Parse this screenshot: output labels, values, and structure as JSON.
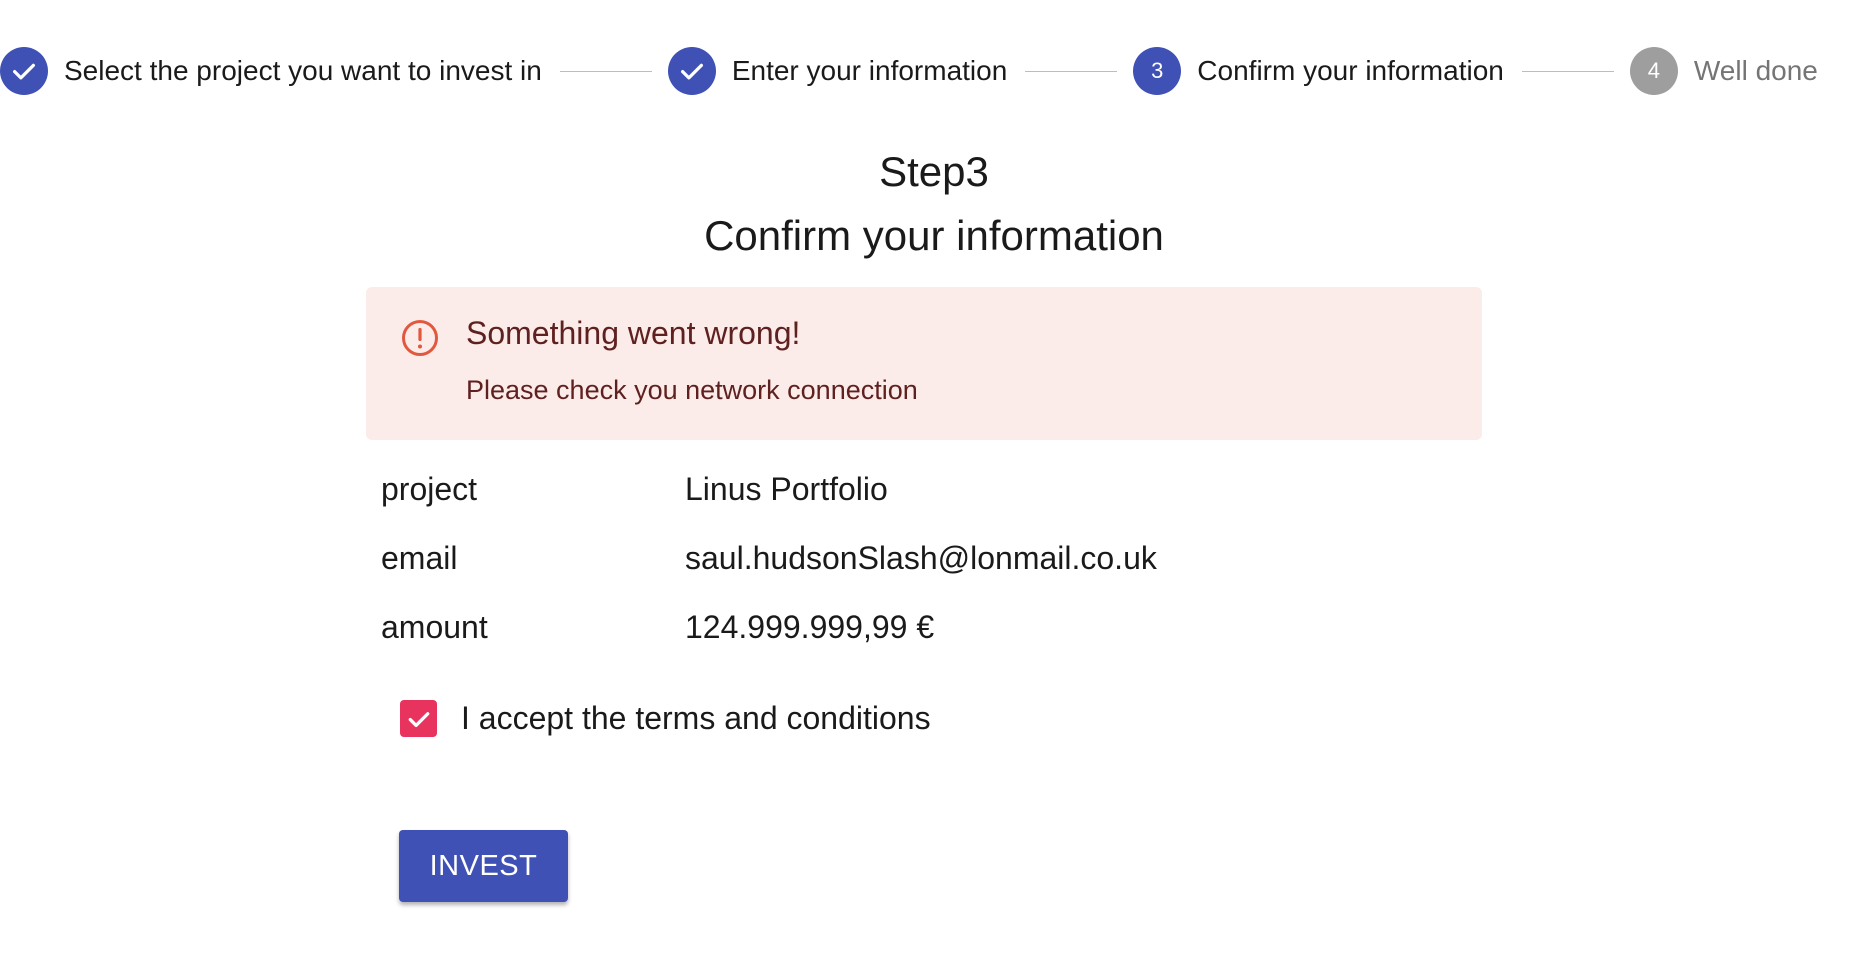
{
  "colors": {
    "primary": "#3f51b5",
    "pending": "#9e9e9e",
    "alert_bg": "#fbecea",
    "alert_text": "#5f2120",
    "alert_icon": "#e2583e",
    "checkbox": "#e8335e"
  },
  "stepper": {
    "steps": [
      {
        "label": "Select the project you want to invest in",
        "status": "completed",
        "icon": "check-icon"
      },
      {
        "label": "Enter your information",
        "status": "completed",
        "icon": "check-icon"
      },
      {
        "label": "Confirm your information",
        "status": "active",
        "number": "3"
      },
      {
        "label": "Well done",
        "status": "pending",
        "number": "4"
      }
    ]
  },
  "heading": {
    "step": "Step3",
    "title": "Confirm your information"
  },
  "alert": {
    "icon": "error-outline-icon",
    "title": "Something went wrong!",
    "message": "Please check you network connection"
  },
  "info": {
    "rows": [
      {
        "key": "project",
        "value": "Linus Portfolio"
      },
      {
        "key": "email",
        "value": "saul.hudsonSlash@lonmail.co.uk"
      },
      {
        "key": "amount",
        "value": "124.999.999,99 €"
      }
    ]
  },
  "terms": {
    "checked": true,
    "label": "I accept the terms and conditions"
  },
  "actions": {
    "invest_label": "INVEST"
  }
}
